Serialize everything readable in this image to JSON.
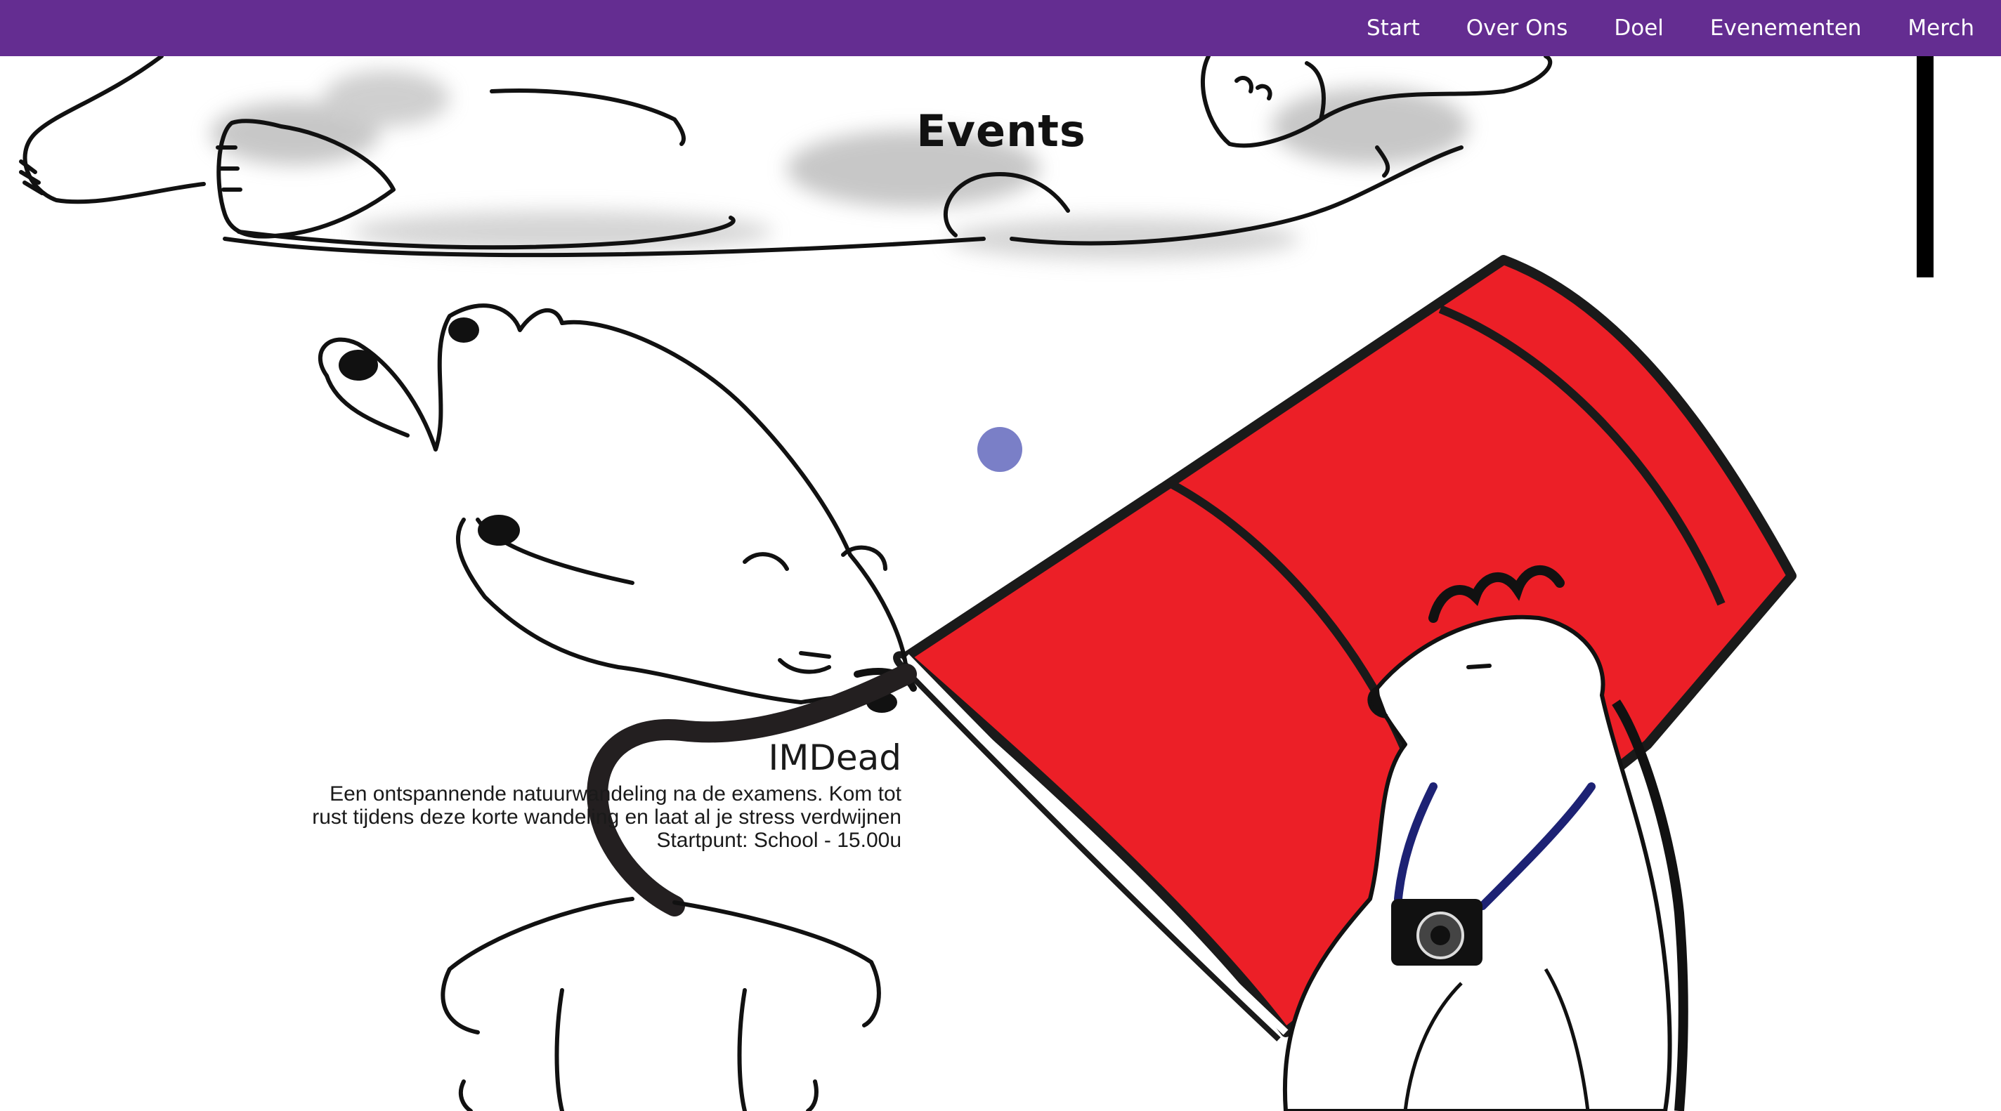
{
  "nav": {
    "items": [
      {
        "label": "Start"
      },
      {
        "label": "Over Ons"
      },
      {
        "label": "Doel"
      },
      {
        "label": "Evenementen"
      },
      {
        "label": "Merch"
      }
    ]
  },
  "page": {
    "title": "Events"
  },
  "event": {
    "title": "IMDead",
    "description": "Een ontspannende natuurwandeling na de examens. Kom tot rust tijdens deze korte wandeling en laat al je stress verdwijnen",
    "meta": "Startpunt: School - 15.00u"
  },
  "colors": {
    "nav_background": "#642d91",
    "timeline_top": "#8a5bab",
    "timeline_bottom": "#6f8ed0",
    "timeline_dot": "#7a7fc7",
    "tunnel_red": "#ec1f27",
    "camera_strap": "#1d2274"
  }
}
